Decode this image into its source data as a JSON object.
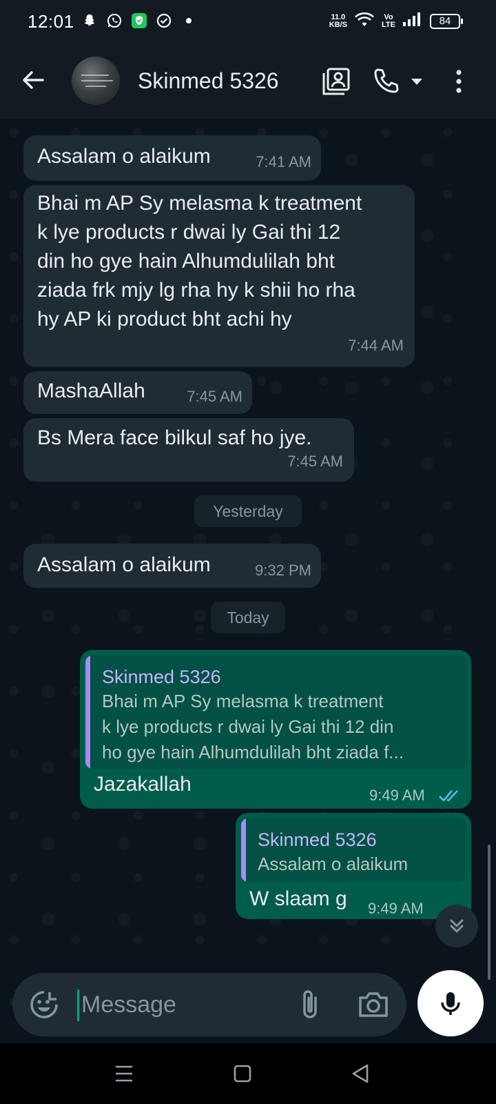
{
  "status_bar": {
    "time": "12:01",
    "net_speed_value": "11.0",
    "net_speed_unit": "KB/S",
    "volte_top": "Vo",
    "volte_bottom": "LTE",
    "battery": "84",
    "icons": [
      "snapchat-icon",
      "whatsapp-icon",
      "shield-icon",
      "check-circle-icon",
      "dot-icon",
      "wifi-icon",
      "signal-icon",
      "battery-icon"
    ]
  },
  "header": {
    "contact_name": "Skinmed 5326",
    "icons": [
      "back-arrow-icon",
      "avatar",
      "contact-card-icon",
      "phone-icon",
      "dropdown-icon",
      "more-vert-icon"
    ]
  },
  "messages": [
    {
      "type": "in",
      "text": "Assalam o alaikum",
      "time": "7:41 AM"
    },
    {
      "type": "in",
      "lines": [
        "Bhai m AP Sy melasma k treatment",
        "k lye products r dwai ly Gai thi 12",
        "din ho gye hain Alhumdulilah bht",
        "ziada frk mjy lg rha hy k shii ho rha",
        "hy AP ki product bht achi hy"
      ],
      "time": "7:44 AM"
    },
    {
      "type": "in",
      "text": "MashaAllah",
      "time": "7:45 AM"
    },
    {
      "type": "in",
      "text": "Bs Mera face bilkul saf ho jye.",
      "time": "7:45 AM"
    },
    {
      "type": "date",
      "text": "Yesterday"
    },
    {
      "type": "in",
      "text": "Assalam o alaikum",
      "time": "9:32 PM"
    },
    {
      "type": "date",
      "text": "Today"
    },
    {
      "type": "out",
      "quote_name": "Skinmed 5326",
      "quote_lines": [
        "Bhai m AP Sy melasma k treatment",
        "k lye products r dwai ly Gai thi 12 din",
        "ho gye hain Alhumdulilah bht ziada f..."
      ],
      "text": "Jazakallah",
      "time": "9:49 AM",
      "status": "read"
    },
    {
      "type": "out",
      "quote_name": "Skinmed 5326",
      "quote_lines": [
        "Assalam o alaikum"
      ],
      "text": "W slaam g",
      "time": "9:49 AM"
    }
  ],
  "composer": {
    "placeholder": "Message",
    "icons": [
      "emoji-icon",
      "attach-icon",
      "camera-icon",
      "mic-icon"
    ]
  },
  "navbar": {
    "icons": [
      "recents-icon",
      "home-icon",
      "back-icon"
    ]
  },
  "colors": {
    "background": "#0b141a",
    "header": "#121b22",
    "incoming": "#202c33",
    "outgoing": "#005c4b",
    "accent": "#00a884",
    "read_tick": "#53bdeb",
    "quote_name": "#c4b5fd"
  }
}
